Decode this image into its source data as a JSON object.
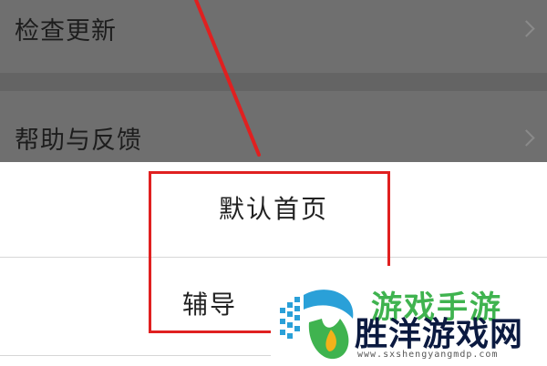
{
  "settings": {
    "check_update": "检查更新",
    "help_feedback": "帮助与反馈"
  },
  "sheet": {
    "default_home": "默认首页",
    "assist": "辅导"
  },
  "watermark": {
    "brand_top": "游戏手游",
    "brand": "胜洋游戏网",
    "url": "www.sxshengyangmdp.com"
  },
  "colors": {
    "highlight": "#e02020",
    "brand_green": "#3fb34f",
    "brand_dark": "#0b1a40"
  },
  "icons": {
    "row_chevron": "chevron-right-icon",
    "logo": "brand-logo"
  }
}
